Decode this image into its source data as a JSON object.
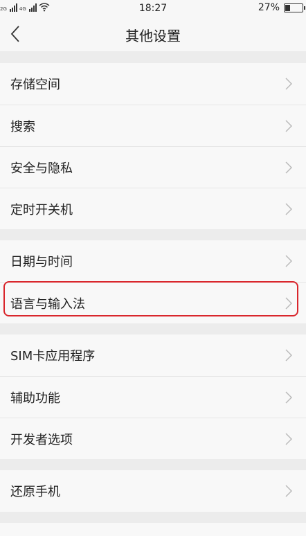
{
  "status_bar": {
    "signal1_tag": "2G",
    "signal2_tag": "4G",
    "time": "18:27",
    "battery_percent": "27%",
    "battery_level": 0.27
  },
  "nav": {
    "title": "其他设置"
  },
  "groups": [
    {
      "items": [
        {
          "label": "存储空间"
        },
        {
          "label": "搜索"
        },
        {
          "label": "安全与隐私"
        },
        {
          "label": "定时开关机"
        }
      ]
    },
    {
      "items": [
        {
          "label": "日期与时间"
        },
        {
          "label": "语言与输入法"
        }
      ]
    },
    {
      "items": [
        {
          "label": "SIM卡应用程序"
        },
        {
          "label": "辅助功能"
        },
        {
          "label": "开发者选项"
        }
      ]
    },
    {
      "items": [
        {
          "label": "还原手机"
        }
      ]
    }
  ],
  "highlighted_item": "语言与输入法",
  "colors": {
    "highlight": "#d9262c",
    "background": "#ececec",
    "row": "#f8f8f8"
  }
}
